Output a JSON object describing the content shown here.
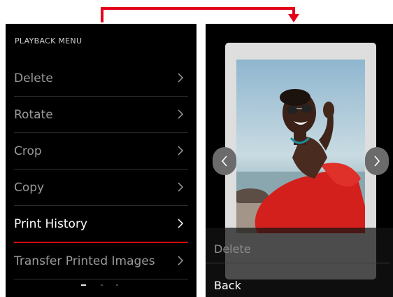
{
  "left_screen": {
    "title": "PLAYBACK MENU",
    "items": [
      {
        "label": "Delete",
        "icon": "chevron-right-icon",
        "active": false
      },
      {
        "label": "Rotate",
        "icon": "chevron-right-icon",
        "active": false
      },
      {
        "label": "Crop",
        "icon": "chevron-right-icon",
        "active": false
      },
      {
        "label": "Copy",
        "icon": "chevron-right-icon",
        "active": false
      },
      {
        "label": "Print History",
        "icon": "chevron-right-icon",
        "active": true
      },
      {
        "label": "Transfer Printed Images",
        "icon": "chevron-right-icon",
        "active": false
      }
    ],
    "page_indicator": {
      "pages": 3,
      "current": 1
    }
  },
  "right_screen": {
    "prev_icon": "chevron-left-icon",
    "next_icon": "chevron-right-icon",
    "context_menu": {
      "delete_label": "Delete",
      "back_label": "Back"
    }
  },
  "colors": {
    "accent_red": "#d20a11",
    "arrow_red": "#e3001b",
    "screen_bg": "#000000",
    "inactive_text": "#9a9a9a",
    "active_text": "#ffffff"
  }
}
